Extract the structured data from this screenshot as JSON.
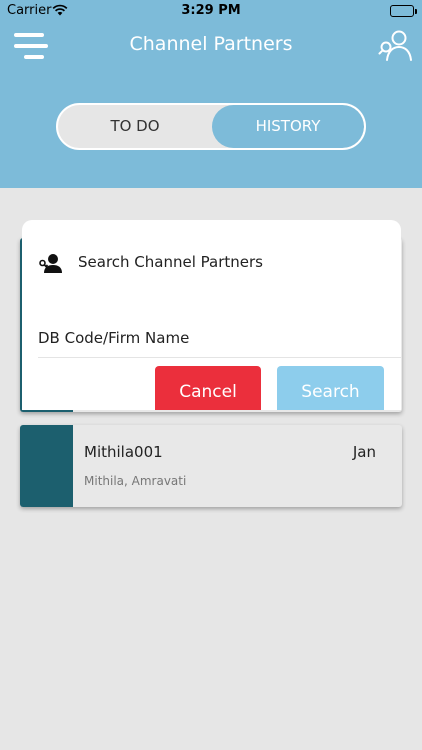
{
  "status_bar": {
    "carrier": "Carrier",
    "time": "3:29 PM"
  },
  "header": {
    "title": "Channel Partners",
    "menu_icon": "hamburger-menu-icon",
    "profile_icon": "user-search-icon"
  },
  "tabs": {
    "todo_label": "TO DO",
    "history_label": "HISTORY",
    "selected": "HISTORY"
  },
  "cards": [
    {
      "name": "Mithila001",
      "month": "Jan",
      "location": "Mithila, Amravati"
    }
  ],
  "dialog": {
    "title": "Search Channel Partners",
    "icon": "person-key-icon",
    "input_placeholder": "DB Code/Firm Name",
    "cancel_label": "Cancel",
    "search_label": "Search"
  },
  "colors": {
    "header_bg": "#7dbbd9",
    "card_accent": "#1c5f6e",
    "cancel_button": "#eb2f3c",
    "search_button": "#8dcdec",
    "background": "#e6e6e6"
  }
}
